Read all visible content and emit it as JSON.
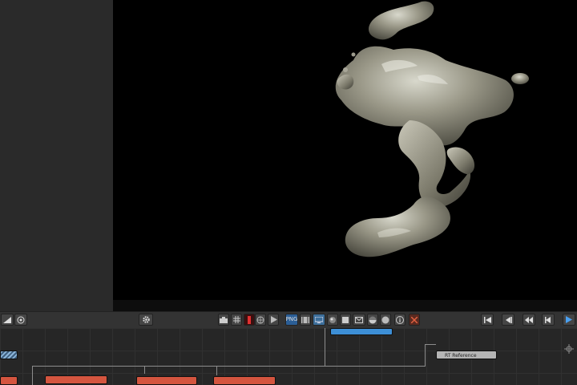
{
  "viewport": {
    "background": "#000000",
    "subject": "liquid-metal-blob"
  },
  "toolbar": {
    "left_icons": [
      "aspect-toggle-icon",
      "target-icon"
    ],
    "center_icons": [
      "gear-icon"
    ],
    "view_icons": [
      "camera-icon",
      "grid-icon",
      "red-channel-icon",
      "wireframe-icon",
      "play-shape-icon",
      "png-label",
      "film-icon",
      "monitor-icon",
      "sphere-icon",
      "square-icon",
      "envelope-icon",
      "material-ball-icon",
      "ball-icon",
      "info-icon",
      "close-icon"
    ],
    "png_label": "PNG",
    "playback_icons": [
      "skip-start-icon",
      "step-back-icon",
      "rewind-icon",
      "prev-frame-icon",
      "play-icon"
    ]
  },
  "node_graph": {
    "nodes": {
      "blue_top": "",
      "blue_top_sub": "",
      "grey_right": "RT Reference",
      "red_center": "",
      "red_right": "",
      "red_left": ""
    }
  },
  "colors": {
    "toolbar": "#333333",
    "node_blue": "#3d8fd6",
    "node_red": "#d4553f",
    "node_grey": "#b5b5b5"
  }
}
